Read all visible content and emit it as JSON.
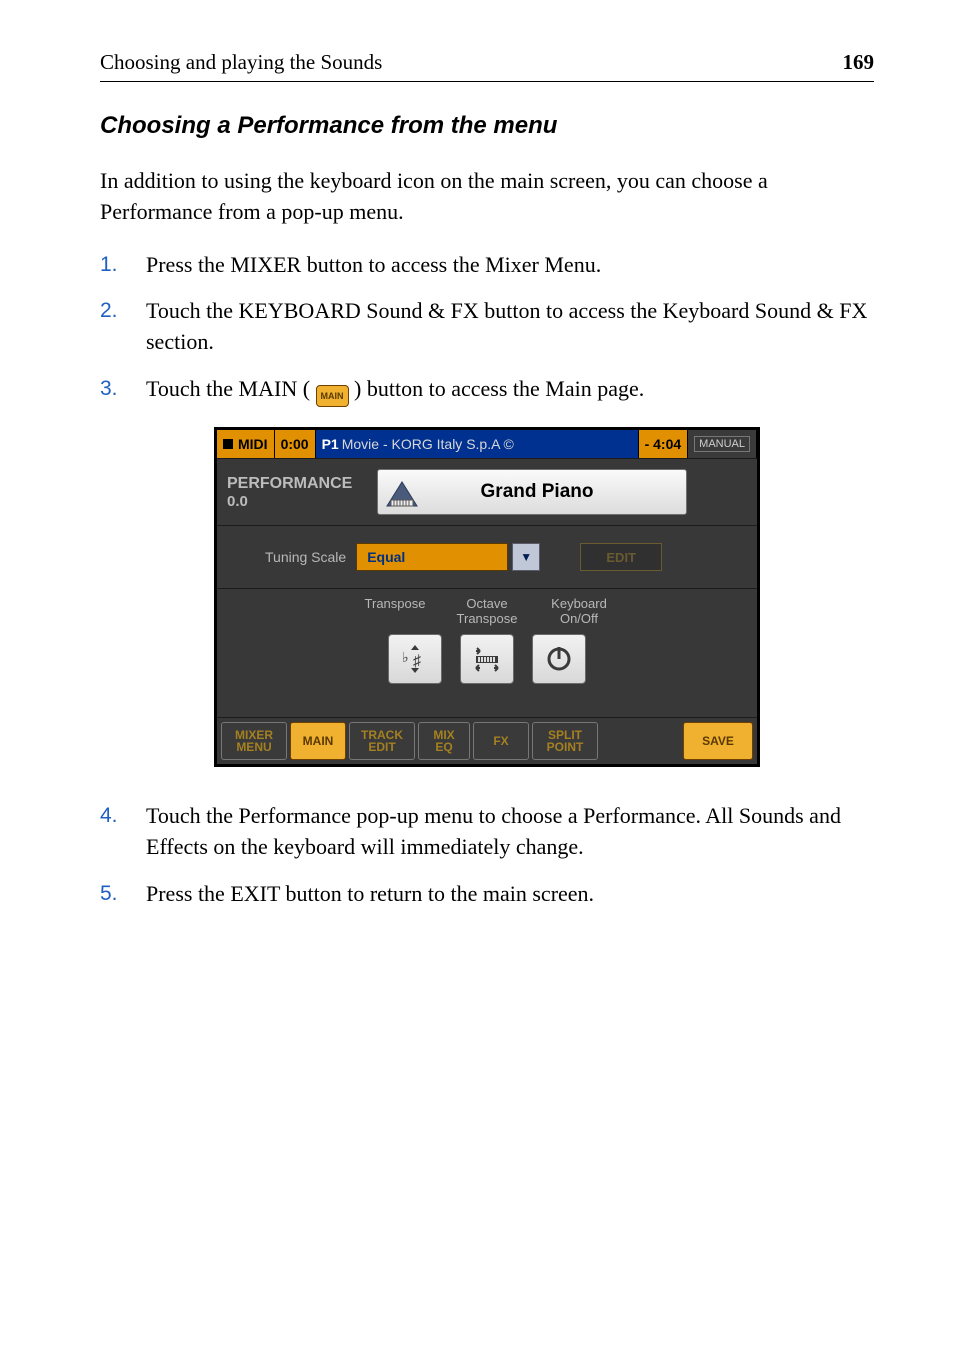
{
  "header": {
    "title": "Choosing and playing the Sounds",
    "page": "169"
  },
  "subheading": "Choosing a Performance from the menu",
  "intro": "In addition to using the keyboard icon on the main screen, you can choose a Performance from a pop-up menu.",
  "steps": [
    "Press the MIXER button to access the Mixer Menu.",
    "Touch the KEYBOARD Sound & FX button to access the Keyboard Sound & FX section.",
    {
      "pre": "Touch the MAIN (",
      "chip": "MAIN",
      "post": ") button to access the Main page."
    },
    "Touch the Performance pop-up menu to choose a Performance. All Sounds and Effects on the keyboard will immediately change.",
    "Press the EXIT button to return to the main screen."
  ],
  "shot": {
    "titlebar": {
      "midi_label": "MIDI",
      "midi_time": "0:00",
      "song_prefix": "P1",
      "song_title": "Movie - KORG Italy S.p.A ©",
      "right_time": "- 4:04",
      "manual": "MANUAL"
    },
    "performance": {
      "label": "PERFORMANCE",
      "number": "0.0",
      "name": "Grand Piano"
    },
    "tuning": {
      "label": "Tuning Scale",
      "value": "Equal",
      "edit": "EDIT"
    },
    "icons": {
      "transpose": "Transpose",
      "octave": "Octave\nTranspose",
      "keyboard_onoff": "Keyboard\nOn/Off"
    },
    "tabs": {
      "mixer_menu": "MIXER\nMENU",
      "main": "MAIN",
      "track_edit": "TRACK\nEDIT",
      "mix_eq": "MIX\nEQ",
      "fx": "FX",
      "split_point": "SPLIT\nPOINT",
      "save": "SAVE"
    }
  }
}
